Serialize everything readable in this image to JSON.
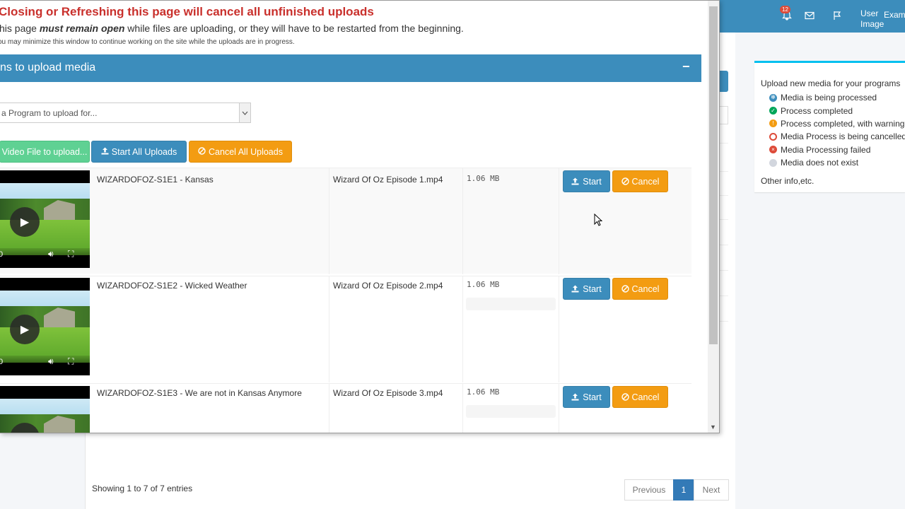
{
  "topbar": {
    "notification_count": "12",
    "user_image_label": "User Image",
    "user_name": "Examp"
  },
  "legend": {
    "title": "Upload new media for your programs",
    "items": [
      {
        "label": "Media is being processed",
        "color": "#3c8dbc",
        "icon": "gear-icon"
      },
      {
        "label": "Process completed",
        "color": "#00a65a",
        "icon": "check-icon"
      },
      {
        "label": "Process completed, with warning",
        "color": "#f39c12",
        "icon": "warning-icon"
      },
      {
        "label": "Media Process is being cancelled",
        "color": "#dd4b39",
        "icon": "ban-icon"
      },
      {
        "label": "Media Processing failed",
        "color": "#dd4b39",
        "icon": "times-icon"
      },
      {
        "label": "Media does not exist",
        "color": "#d2d6de",
        "icon": "circle-icon"
      }
    ],
    "other": "Other info,etc."
  },
  "background_table": {
    "showing": "Showing 1 to 7 of 7 entries",
    "pager": {
      "previous": "Previous",
      "current": "1",
      "next": "Next"
    }
  },
  "modal": {
    "warning_title": "Closing or Refreshing this page will cancel all unfinished uploads",
    "warning_line_pre": "his page ",
    "warning_line_em": "must remain open",
    "warning_line_post": " while files are uploading, or they will have to be restarted from the beginning.",
    "warning_small": "ou may minimize this window to continue working on the site while the uploads are in progress.",
    "instructions_title": "ns to upload media",
    "collapse_symbol": "−",
    "program_select_text": "a Program to upload for...",
    "buttons": {
      "add_file": "Video File to upload...",
      "start_all": "Start All Uploads",
      "cancel_all": "Cancel All Uploads"
    },
    "uploads": [
      {
        "title": "WIZARDOFOZ-S1E1 - Kansas",
        "filename": "Wizard Of Oz Episode 1.mp4",
        "size": "1.06 MB",
        "time": "0",
        "start": "Start",
        "cancel": "Cancel",
        "progress": 0
      },
      {
        "title": "WIZARDOFOZ-S1E2 - Wicked Weather",
        "filename": "Wizard Of Oz Episode 2.mp4",
        "size": "1.06 MB",
        "time": "0",
        "start": "Start",
        "cancel": "Cancel",
        "progress": 0
      },
      {
        "title": "WIZARDOFOZ-S1E3 - We are not in Kansas Anymore",
        "filename": "Wizard Of Oz Episode 3.mp4",
        "size": "1.06 MB",
        "time": "",
        "start": "Start",
        "cancel": "Cancel",
        "progress": 0
      }
    ]
  }
}
